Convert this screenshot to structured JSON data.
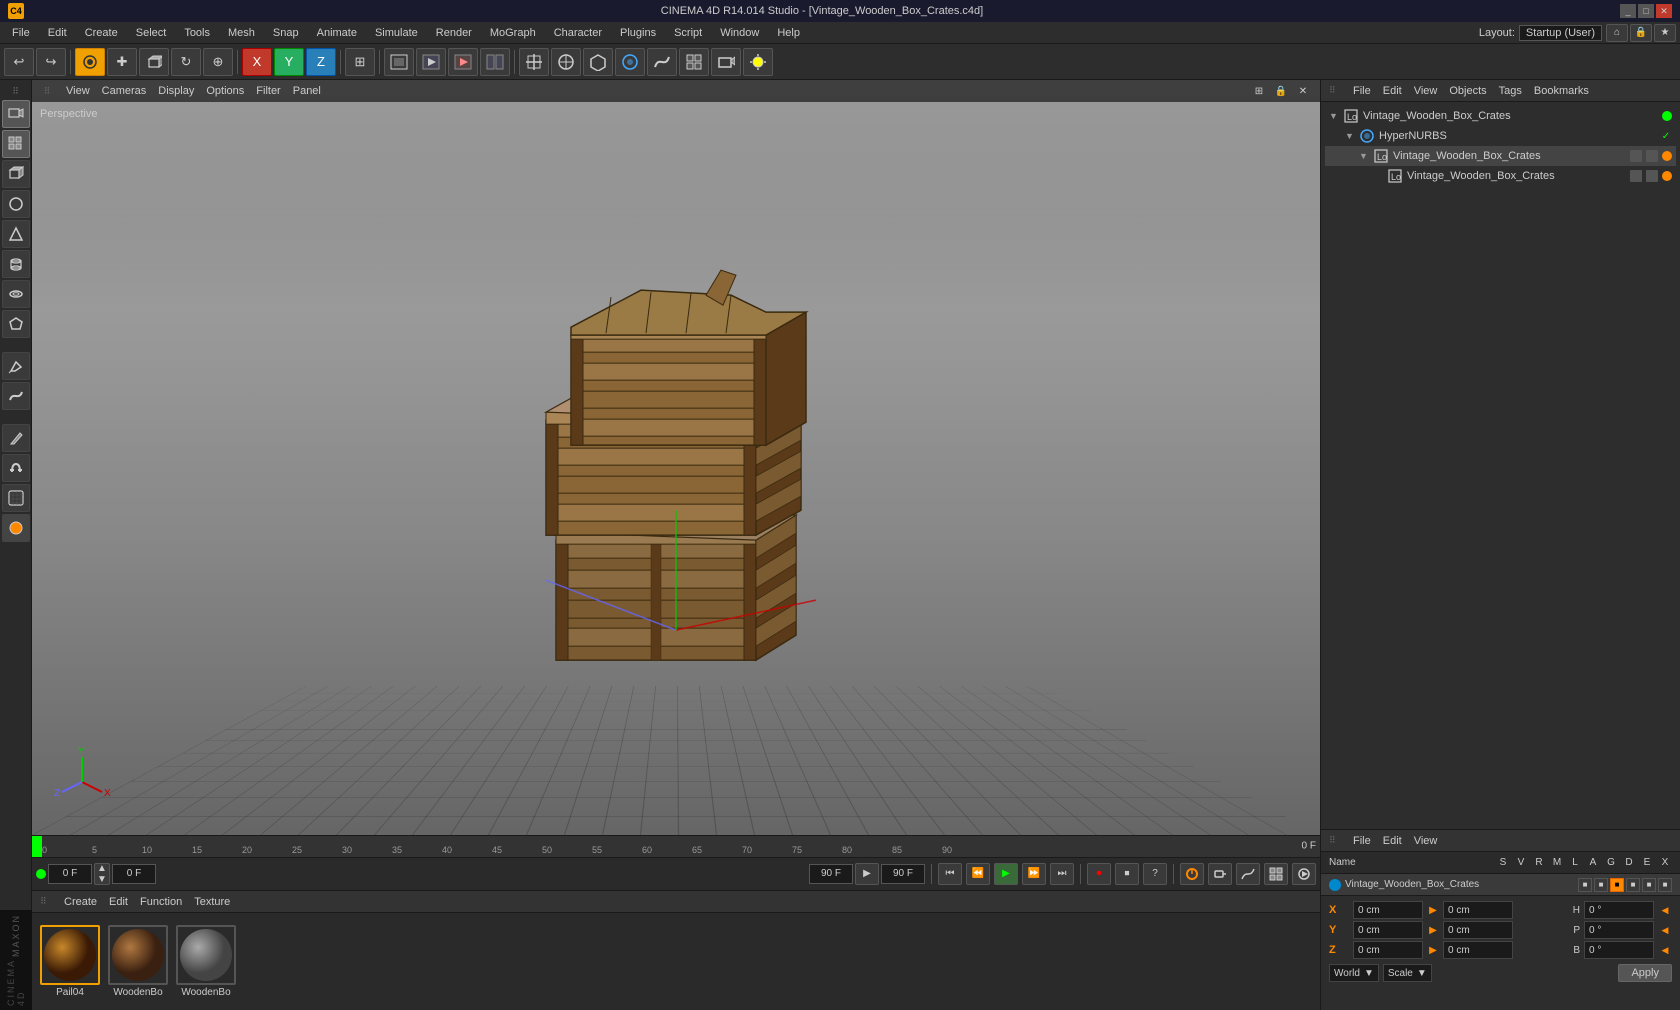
{
  "window": {
    "title": "CINEMA 4D R14.014 Studio - [Vintage_Wooden_Box_Crates.c4d]",
    "layout": "Startup (User)"
  },
  "menu": {
    "items": [
      "File",
      "Edit",
      "Create",
      "Select",
      "Tools",
      "Mesh",
      "Snap",
      "Animate",
      "Simulate",
      "Render",
      "MoGraph",
      "Character",
      "Plugins",
      "Script",
      "Window",
      "Help"
    ]
  },
  "toolbar": {
    "undo": "↩",
    "redo": "↪"
  },
  "viewport": {
    "label": "Perspective",
    "menus": [
      "View",
      "Cameras",
      "Display",
      "Options",
      "Filter",
      "Panel"
    ]
  },
  "timeline": {
    "current_frame": "0 F",
    "end_frame": "90 F",
    "fps_display": "90 F",
    "frame_indicator": "0 F",
    "ticks": [
      "0",
      "5",
      "10",
      "15",
      "20",
      "25",
      "30",
      "35",
      "40",
      "45",
      "50",
      "55",
      "60",
      "65",
      "70",
      "75",
      "80",
      "85",
      "90"
    ]
  },
  "materials": {
    "menus": [
      "Create",
      "Edit",
      "Function",
      "Texture"
    ],
    "items": [
      {
        "name": "Pail04",
        "selected": true
      },
      {
        "name": "WoodenBo",
        "selected": false
      },
      {
        "name": "WoodenBo",
        "selected": false
      }
    ]
  },
  "object_manager": {
    "menus": [
      "File",
      "Edit",
      "View",
      "Objects",
      "Tags",
      "Bookmarks"
    ],
    "objects": [
      {
        "name": "Vintage_Wooden_Box_Crates",
        "level": 0,
        "type": "root",
        "dot1": "green",
        "dot2": "gray"
      },
      {
        "name": "HyperNURBS",
        "level": 1,
        "type": "hyper",
        "dot1": "check",
        "dot2": "gray"
      },
      {
        "name": "Vintage_Wooden_Box_Crates",
        "level": 2,
        "type": "obj",
        "dot1": "gray",
        "dot2": "orange"
      },
      {
        "name": "Vintage_Wooden_Box_Crates",
        "level": 3,
        "type": "obj",
        "dot1": "gray",
        "dot2": "orange"
      }
    ]
  },
  "attribute_manager": {
    "menus": [
      "File",
      "Edit",
      "View"
    ],
    "selected_object": "Vintage_Wooden_Box_Crates",
    "columns": [
      "S",
      "V",
      "R",
      "M",
      "L",
      "A",
      "G",
      "D",
      "E",
      "X"
    ],
    "coords": {
      "x_label": "X",
      "x_pos": "0 cm",
      "x_size": "0 cm",
      "x_right_label": "H",
      "x_right_val": "0 °",
      "y_label": "Y",
      "y_pos": "0 cm",
      "y_size": "0 cm",
      "y_right_label": "P",
      "y_right_val": "0 °",
      "z_label": "Z",
      "z_pos": "0 cm",
      "z_size": "0 cm",
      "z_right_label": "B",
      "z_right_val": "0 °"
    },
    "mode_options": [
      "World",
      "Scale"
    ],
    "apply_label": "Apply"
  },
  "playback": {
    "buttons": [
      "⏮",
      "⏪",
      "▶",
      "⏩",
      "⏭",
      "⏺"
    ],
    "frame_in": "0 F",
    "frame_out": "90 F"
  }
}
